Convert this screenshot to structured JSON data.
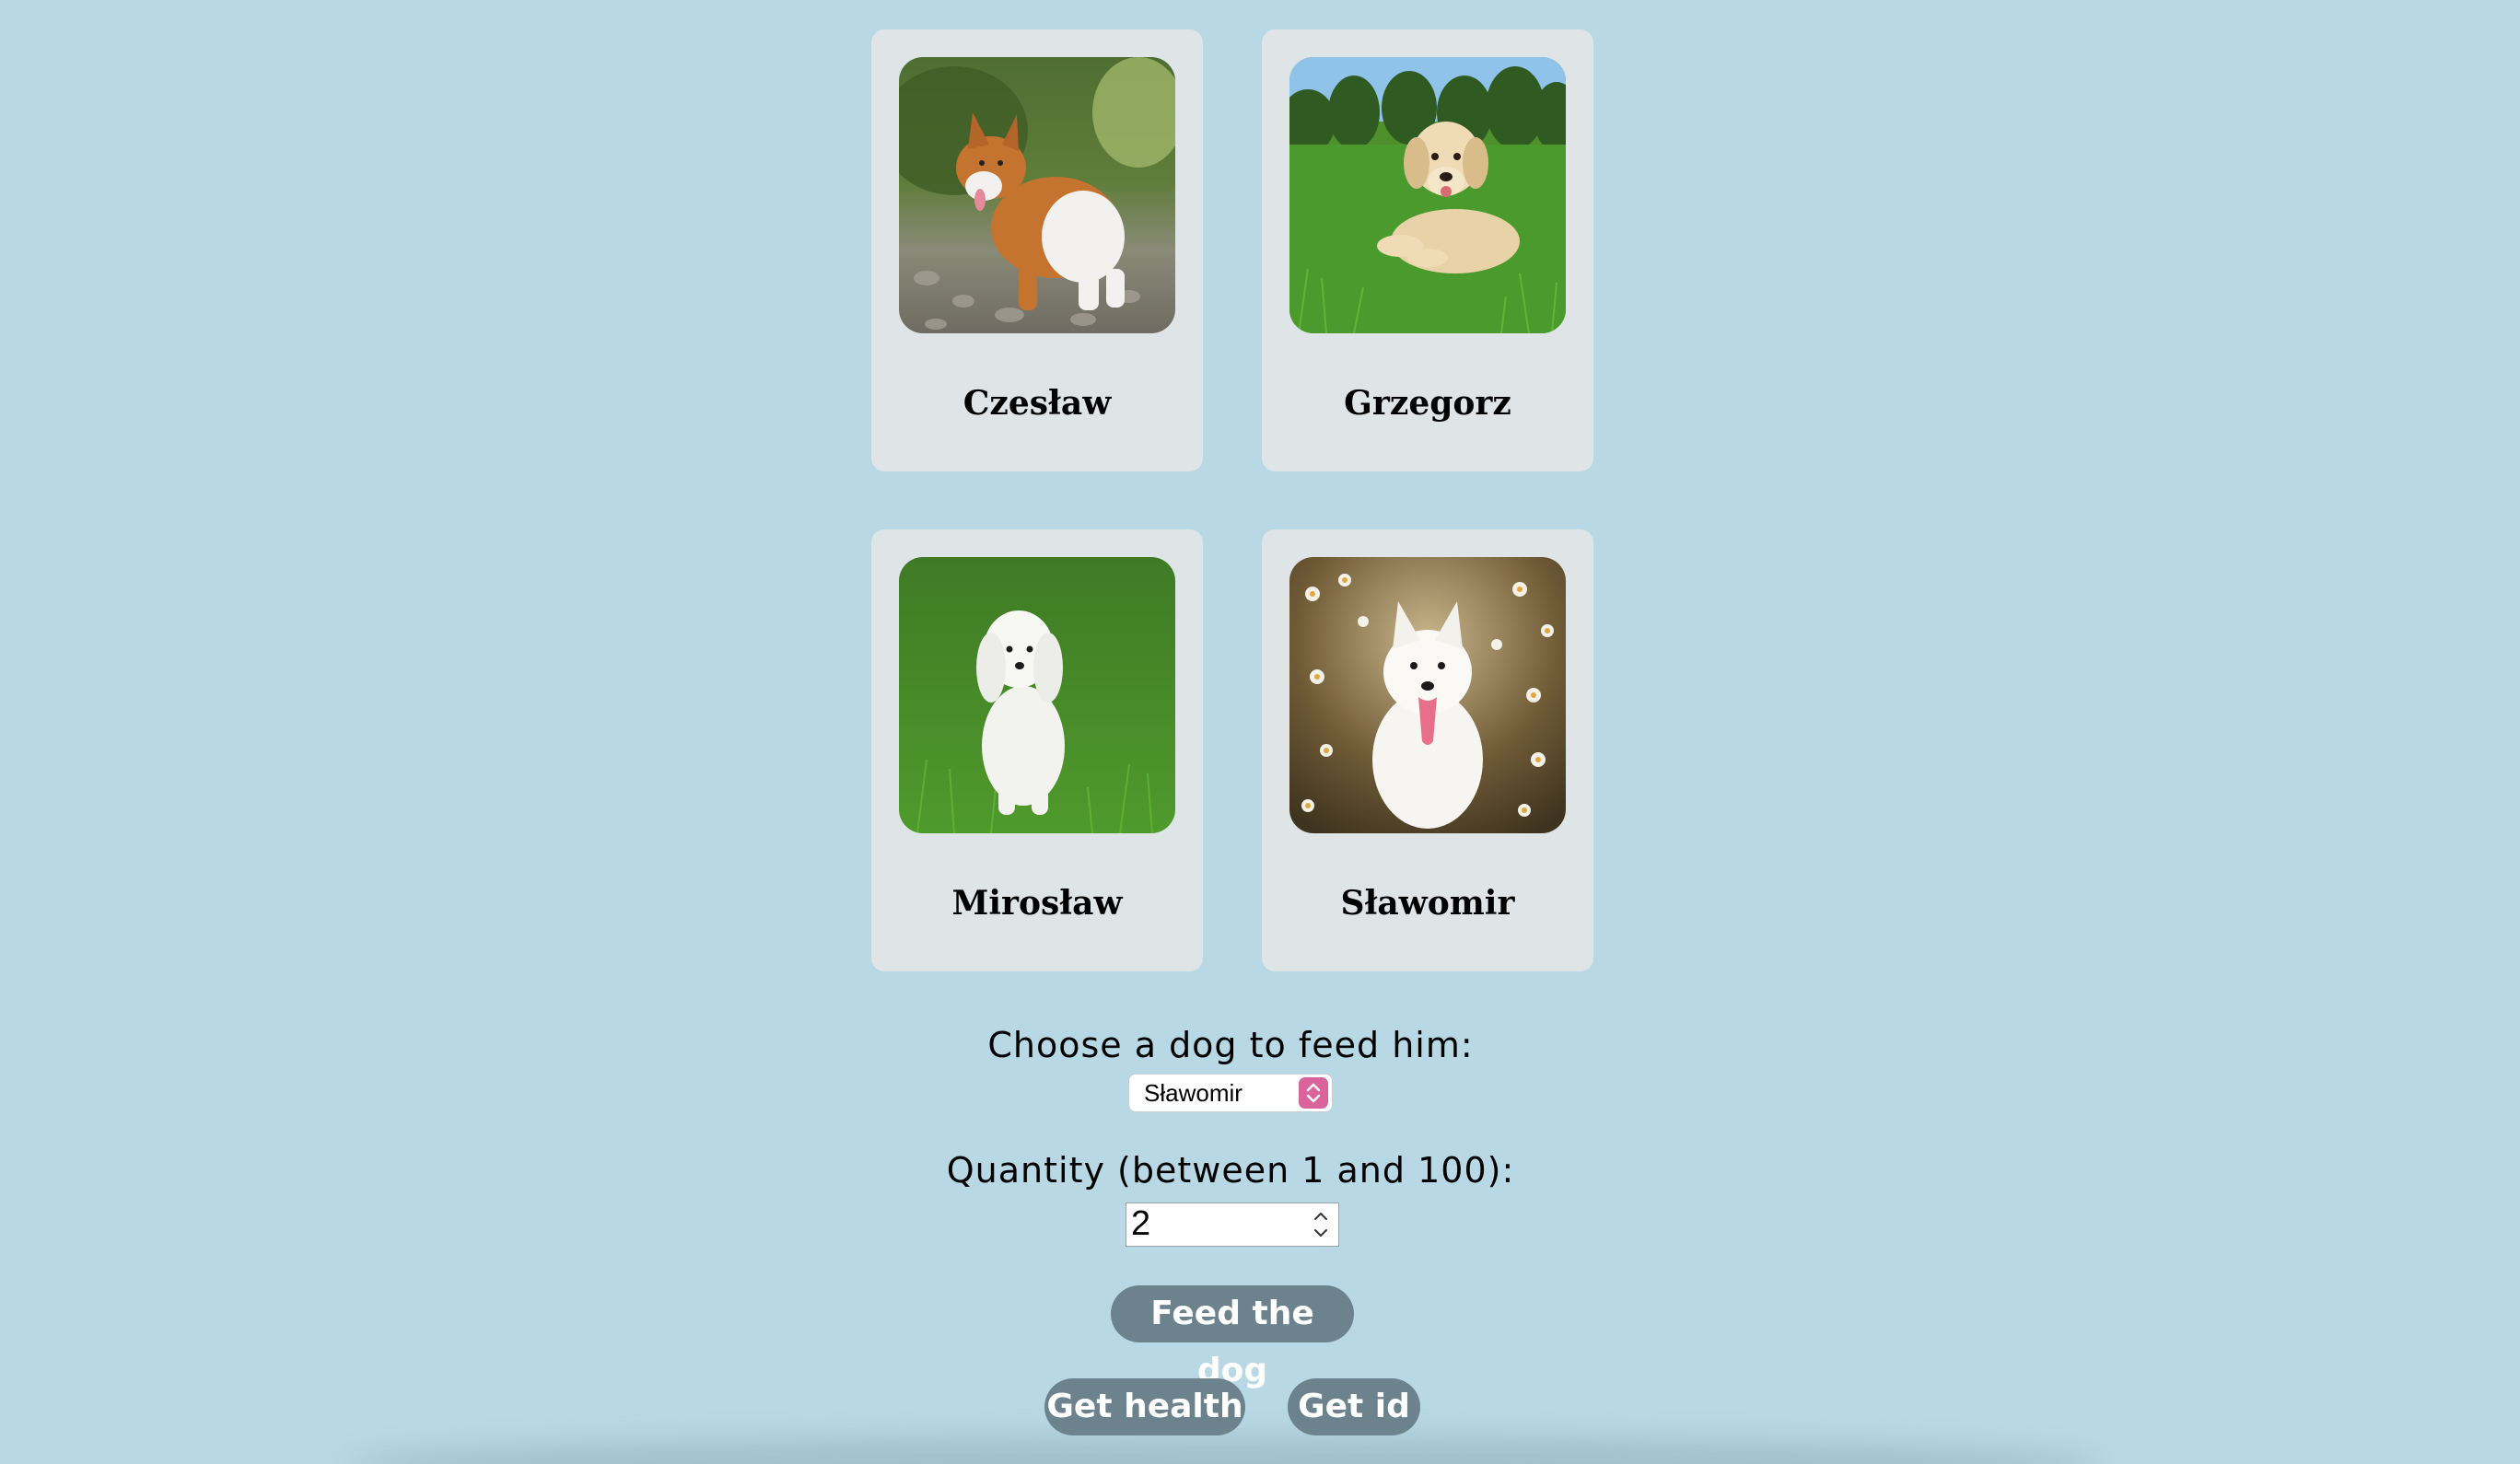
{
  "dogs": [
    {
      "name": "Czesław",
      "breed_icon": "corgi-photo"
    },
    {
      "name": "Grzegorz",
      "breed_icon": "golden-retriever-photo"
    },
    {
      "name": "Mirosław",
      "breed_icon": "maltese-photo"
    },
    {
      "name": "Sławomir",
      "breed_icon": "samoyed-photo"
    }
  ],
  "form": {
    "choose_label": "Choose a dog to feed him:",
    "selected_dog": "Sławomir",
    "quantity_label": "Quantity (between 1 and 100):",
    "quantity_value": "2"
  },
  "buttons": {
    "feed": "Feed the dog",
    "health": "Get health",
    "id": "Get id"
  },
  "colors": {
    "background": "#b7d8e4",
    "card": "#dfe5e6",
    "button": "#6c828c",
    "select_accent": "#d9639a"
  }
}
